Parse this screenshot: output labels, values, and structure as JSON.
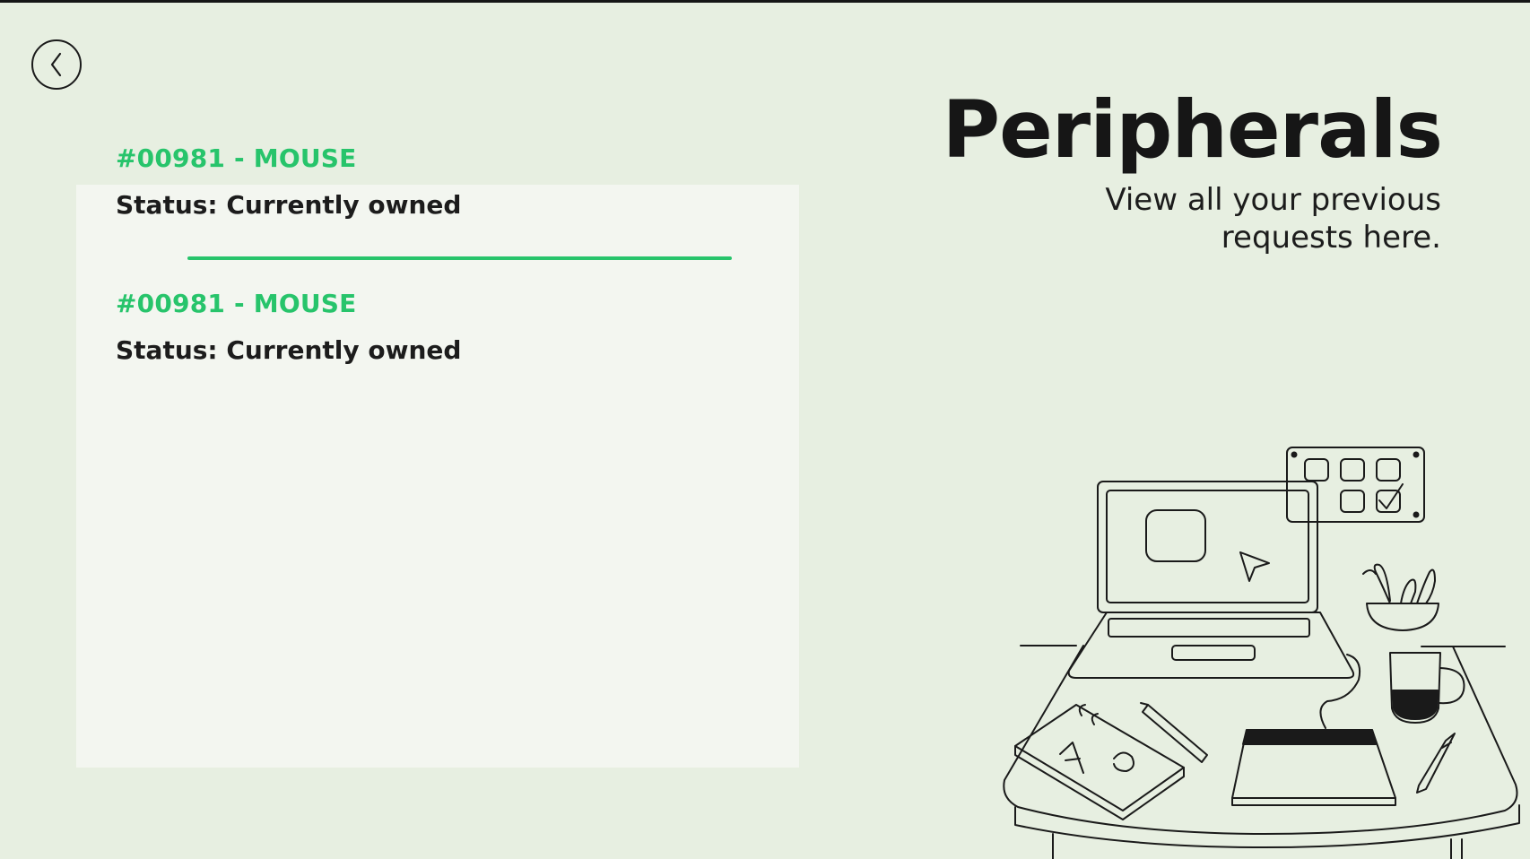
{
  "header": {
    "title": "Peripherals",
    "subtitle": "View all your previous requests here."
  },
  "requests": [
    {
      "id_label": "#00981 - MOUSE",
      "status": "Status: Currently owned"
    },
    {
      "id_label": "#00981 - MOUSE",
      "status": "Status: Currently owned"
    }
  ],
  "icons": {
    "back": "chevron-left-icon",
    "illustration": "desk-workspace-illustration"
  },
  "colors": {
    "background": "#e7efe1",
    "panel": "#f3f6f0",
    "accent": "#27c46b",
    "text": "#1c1c1c"
  }
}
